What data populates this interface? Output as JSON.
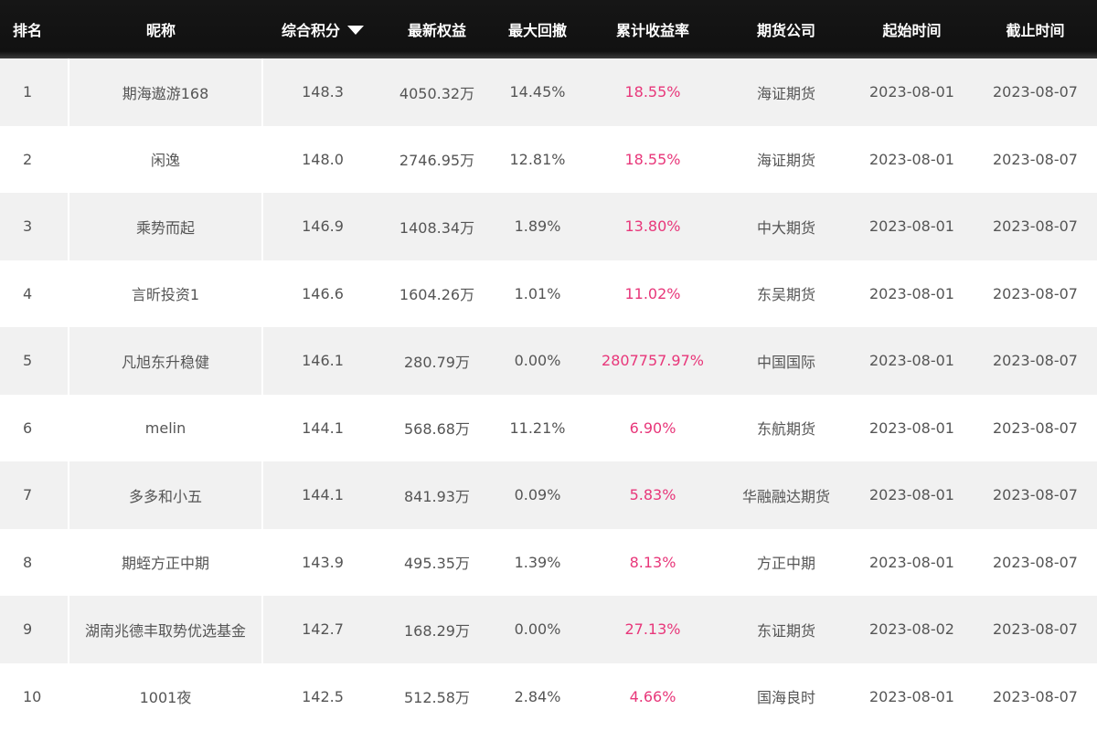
{
  "header": {
    "rank": "排名",
    "nickname": "昵称",
    "score": "综合积分",
    "equity": "最新权益",
    "drawdown": "最大回撤",
    "return": "累计收益率",
    "company": "期货公司",
    "start": "起始时间",
    "end": "截止时间"
  },
  "sort_icon": "caret-down-icon",
  "colors": {
    "header_bg": "#111111",
    "return_text": "#e8377a",
    "odd_row_bg": "#f1f1f1"
  },
  "rows": [
    {
      "rank": "1",
      "nickname": "期海遨游168",
      "score": "148.3",
      "equity": "4050.32万",
      "drawdown": "14.45%",
      "return": "18.55%",
      "company": "海证期货",
      "start": "2023-08-01",
      "end": "2023-08-07"
    },
    {
      "rank": "2",
      "nickname": "闲逸",
      "score": "148.0",
      "equity": "2746.95万",
      "drawdown": "12.81%",
      "return": "18.55%",
      "company": "海证期货",
      "start": "2023-08-01",
      "end": "2023-08-07"
    },
    {
      "rank": "3",
      "nickname": "乘势而起",
      "score": "146.9",
      "equity": "1408.34万",
      "drawdown": "1.89%",
      "return": "13.80%",
      "company": "中大期货",
      "start": "2023-08-01",
      "end": "2023-08-07"
    },
    {
      "rank": "4",
      "nickname": "言昕投资1",
      "score": "146.6",
      "equity": "1604.26万",
      "drawdown": "1.01%",
      "return": "11.02%",
      "company": "东吴期货",
      "start": "2023-08-01",
      "end": "2023-08-07"
    },
    {
      "rank": "5",
      "nickname": "凡旭东升稳健",
      "score": "146.1",
      "equity": "280.79万",
      "drawdown": "0.00%",
      "return": "2807757.97%",
      "company": "中国国际",
      "start": "2023-08-01",
      "end": "2023-08-07"
    },
    {
      "rank": "6",
      "nickname": "melin",
      "score": "144.1",
      "equity": "568.68万",
      "drawdown": "11.21%",
      "return": "6.90%",
      "company": "东航期货",
      "start": "2023-08-01",
      "end": "2023-08-07"
    },
    {
      "rank": "7",
      "nickname": "多多和小五",
      "score": "144.1",
      "equity": "841.93万",
      "drawdown": "0.09%",
      "return": "5.83%",
      "company": "华融融达期货",
      "start": "2023-08-01",
      "end": "2023-08-07"
    },
    {
      "rank": "8",
      "nickname": "期蛭方正中期",
      "score": "143.9",
      "equity": "495.35万",
      "drawdown": "1.39%",
      "return": "8.13%",
      "company": "方正中期",
      "start": "2023-08-01",
      "end": "2023-08-07"
    },
    {
      "rank": "9",
      "nickname": "湖南兆德丰取势优选基金",
      "score": "142.7",
      "equity": "168.29万",
      "drawdown": "0.00%",
      "return": "27.13%",
      "company": "东证期货",
      "start": "2023-08-02",
      "end": "2023-08-07"
    },
    {
      "rank": "10",
      "nickname": "1001夜",
      "score": "142.5",
      "equity": "512.58万",
      "drawdown": "2.84%",
      "return": "4.66%",
      "company": "国海良时",
      "start": "2023-08-01",
      "end": "2023-08-07"
    }
  ]
}
